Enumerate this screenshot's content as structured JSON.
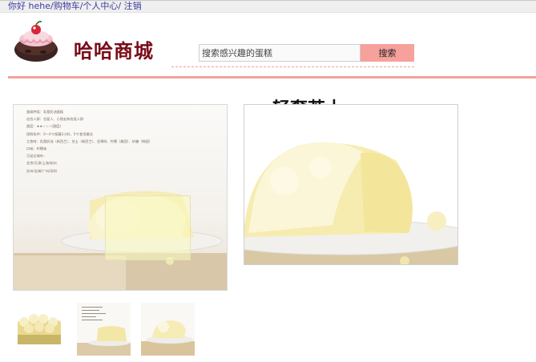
{
  "topbar": {
    "greeting": "你好 hehe",
    "sep1": "/",
    "cart": "购物车",
    "sep2": "/",
    "profile": "个人中心",
    "sep3": "/ ",
    "logout": "注销"
  },
  "brand": {
    "name": "哈哈商城",
    "icon": "cake-logo-icon"
  },
  "search": {
    "placeholder": "搜索感兴趣的蛋糕",
    "value": "",
    "button_label": "搜索"
  },
  "product": {
    "title": "轻奢芝士",
    "info_lines": [
      "蛋糕种类：乳脂奶油蛋糕",
      "适合人群：恋爱人、小朋友和各类人群",
      "甜度：★★☆☆☆",
      "保鲜条件：0～4℃保藏2小时，5℃食用最佳",
      "主食材：乳脂奶油（新西兰）、芝士（新西兰）、坚果碎、柠檬（美国）、砂糖（韩国）",
      "口味：柠檬味",
      "可送达城市：",
      "北京/天津/上海/杭州",
      "苏州/无锡/广州/深圳"
    ],
    "sweet_legend": "(甜度)"
  },
  "colors": {
    "accent": "#f3a19c",
    "brand": "#7a0c18",
    "link": "#3a3aa0"
  }
}
